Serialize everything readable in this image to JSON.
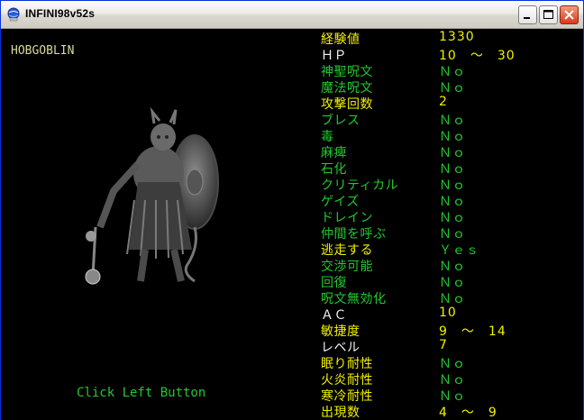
{
  "window": {
    "title": "INFINI98v52s",
    "colors": {
      "title_text": "#000000",
      "background": "#000000"
    }
  },
  "monster": {
    "name": "HOBGOBLIN",
    "image_icon": "hobgoblin-portrait"
  },
  "hint": "Click Left Button",
  "stats": [
    {
      "label": "経験値",
      "value": "1330",
      "label_color": "yellow",
      "value_color": "yellow"
    },
    {
      "label": "ＨＰ",
      "value": "10　～　30",
      "label_color": "white",
      "value_color": "yellow"
    },
    {
      "label": "神聖呪文",
      "value": "Ｎｏ",
      "label_color": "green",
      "value_color": "green"
    },
    {
      "label": "魔法呪文",
      "value": "Ｎｏ",
      "label_color": "green",
      "value_color": "green"
    },
    {
      "label": "攻撃回数",
      "value": "2",
      "label_color": "yellow",
      "value_color": "yellow"
    },
    {
      "label": "ブレス",
      "value": "Ｎｏ",
      "label_color": "green",
      "value_color": "green"
    },
    {
      "label": "毒",
      "value": "Ｎｏ",
      "label_color": "green",
      "value_color": "green"
    },
    {
      "label": "麻痺",
      "value": "Ｎｏ",
      "label_color": "green",
      "value_color": "green"
    },
    {
      "label": "石化",
      "value": "Ｎｏ",
      "label_color": "green",
      "value_color": "green"
    },
    {
      "label": "クリティカル",
      "value": "Ｎｏ",
      "label_color": "green",
      "value_color": "green"
    },
    {
      "label": "ゲイズ",
      "value": "Ｎｏ",
      "label_color": "green",
      "value_color": "green"
    },
    {
      "label": "ドレイン",
      "value": "Ｎｏ",
      "label_color": "green",
      "value_color": "green"
    },
    {
      "label": "仲間を呼ぶ",
      "value": "Ｎｏ",
      "label_color": "green",
      "value_color": "green"
    },
    {
      "label": "逃走する",
      "value": "Ｙｅｓ",
      "label_color": "yellow",
      "value_color": "green"
    },
    {
      "label": "交渉可能",
      "value": "Ｎｏ",
      "label_color": "green",
      "value_color": "green"
    },
    {
      "label": "回復",
      "value": "Ｎｏ",
      "label_color": "green",
      "value_color": "green"
    },
    {
      "label": "呪文無効化",
      "value": "Ｎｏ",
      "label_color": "green",
      "value_color": "green"
    },
    {
      "label": "ＡＣ",
      "value": "10",
      "label_color": "white",
      "value_color": "yellow"
    },
    {
      "label": "敏捷度",
      "value": "9　～　14",
      "label_color": "yellow",
      "value_color": "yellow"
    },
    {
      "label": "レベル",
      "value": "7",
      "label_color": "white",
      "value_color": "yellow"
    },
    {
      "label": "眠り耐性",
      "value": "Ｎｏ",
      "label_color": "yellow",
      "value_color": "green"
    },
    {
      "label": "火炎耐性",
      "value": "Ｎｏ",
      "label_color": "yellow",
      "value_color": "green"
    },
    {
      "label": "寒冷耐性",
      "value": "Ｎｏ",
      "label_color": "yellow",
      "value_color": "green"
    },
    {
      "label": "出現数",
      "value": "4　～　9",
      "label_color": "yellow",
      "value_color": "yellow"
    }
  ],
  "icons": {
    "app": "app-globe-icon",
    "minimize": "minimize-icon",
    "maximize": "maximize-icon",
    "close": "close-icon"
  }
}
